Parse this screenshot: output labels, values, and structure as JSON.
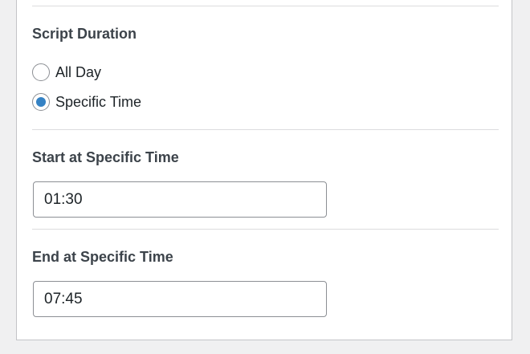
{
  "script_duration": {
    "title": "Script Duration",
    "options": [
      {
        "label": "All Day",
        "checked": false
      },
      {
        "label": "Specific Time",
        "checked": true
      }
    ]
  },
  "start_time": {
    "title": "Start at Specific Time",
    "value": "01:30"
  },
  "end_time": {
    "title": "End at Specific Time",
    "value": "07:45"
  },
  "colors": {
    "accent": "#3582c4",
    "border": "#8c8f94",
    "background": "#f0f0f1"
  }
}
